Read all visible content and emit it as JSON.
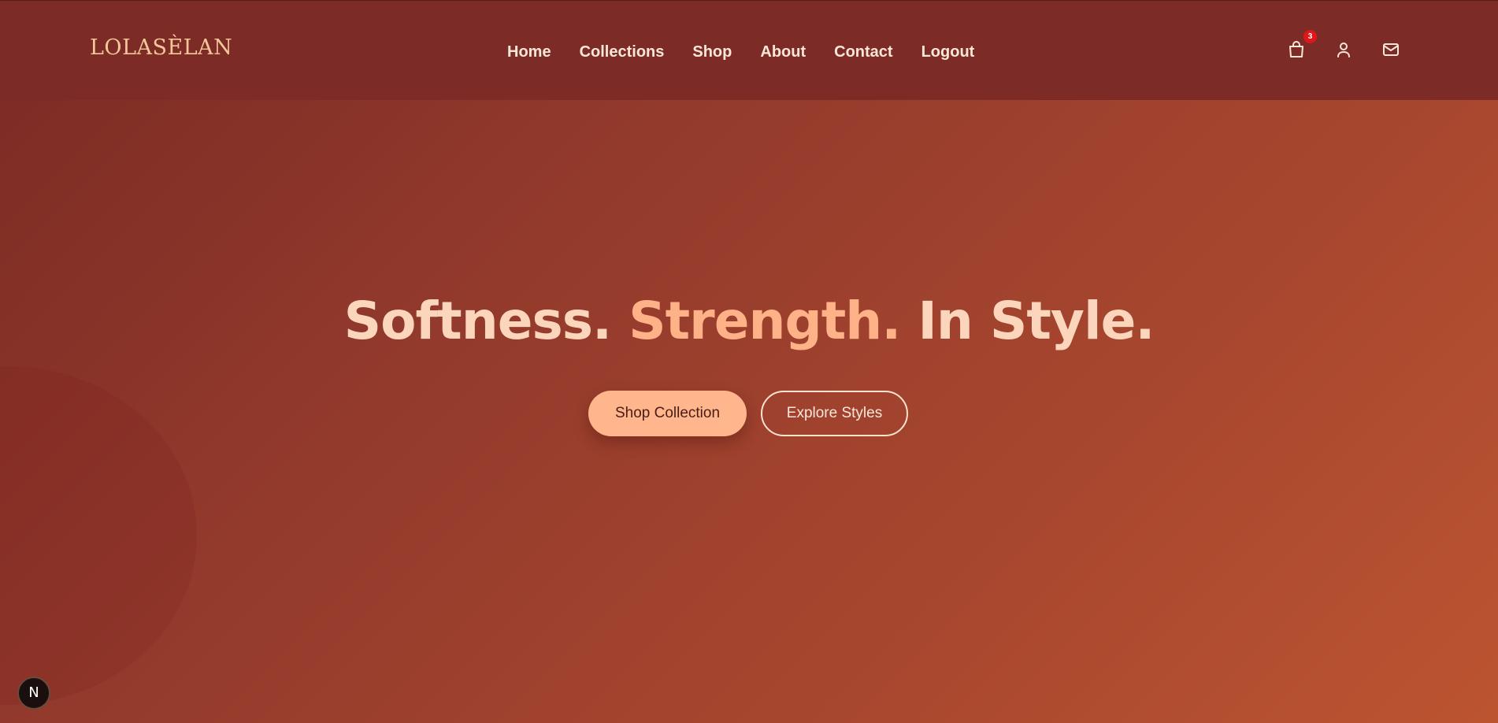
{
  "brand": {
    "logo_text": "LOLASÈLAN"
  },
  "nav": {
    "items": [
      {
        "label": "Home"
      },
      {
        "label": "Collections"
      },
      {
        "label": "Shop"
      },
      {
        "label": "About"
      },
      {
        "label": "Contact"
      },
      {
        "label": "Logout"
      }
    ]
  },
  "header_icons": {
    "cart": {
      "icon": "shopping-bag-icon",
      "count": "3"
    },
    "account": {
      "icon": "user-icon"
    },
    "mail": {
      "icon": "mail-icon"
    }
  },
  "hero": {
    "title_part1": "Softness.",
    "title_part2": "Strength.",
    "title_part3": "In Style.",
    "primary_button": "Shop Collection",
    "secondary_button": "Explore Styles"
  },
  "dev_badge": {
    "label": "N"
  },
  "colors": {
    "header_bg": "#7c2b26",
    "accent": "#ffb68c",
    "hero_text": "#fcd6bc",
    "badge_red": "#e0161a"
  }
}
